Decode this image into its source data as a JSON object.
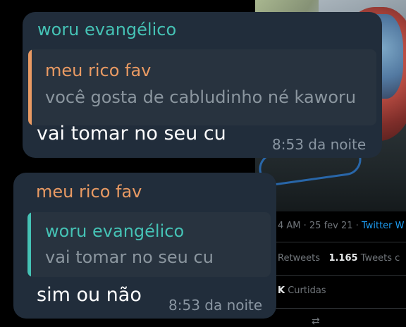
{
  "colors": {
    "chat_bubble_bg": "#212d3b",
    "quote_bg": "#28333f",
    "teal_name": "#45c2b5",
    "orange_name": "#e99a63",
    "twitter_blue": "#1d9bf0"
  },
  "background_tweet": {
    "meta_time": "4 AM · 25 fev 21 · ",
    "meta_via": "Twitter W",
    "retweets_label": "Retweets",
    "quote_tweets_count": "1.165",
    "quote_tweets_label": "Tweets c",
    "likes_count": "K",
    "likes_label": "Curtidas"
  },
  "messages": [
    {
      "sender": "woru evangélico",
      "reply_to_name": "meu rico fav",
      "reply_to_text": "você gosta de cabludinho né kaworu",
      "text": "vai tomar no seu cu",
      "time": "8:53 da noite"
    },
    {
      "sender": "meu rico fav",
      "reply_to_name": "woru evangélico",
      "reply_to_text": "vai tomar no seu cu",
      "text": "sim ou não",
      "time": "8:53 da noite"
    }
  ]
}
